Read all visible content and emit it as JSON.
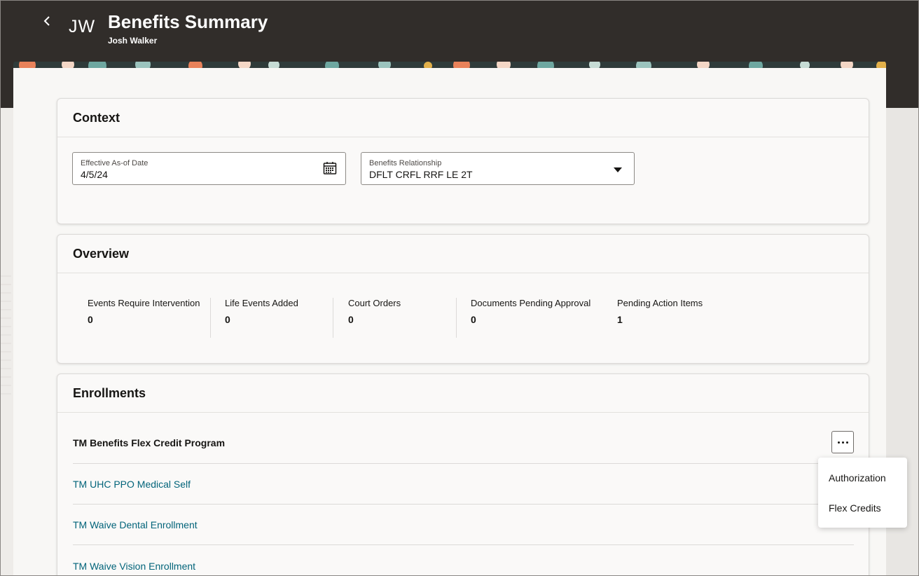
{
  "header": {
    "initials": "JW",
    "title": "Benefits Summary",
    "person_name": "Josh Walker"
  },
  "context": {
    "title": "Context",
    "effective_date": {
      "label": "Effective As-of Date",
      "value": "4/5/24"
    },
    "relationship": {
      "label": "Benefits Relationship",
      "value": "DFLT CRFL RRF LE 2T"
    }
  },
  "overview": {
    "title": "Overview",
    "metrics": [
      {
        "label": "Events Require Intervention",
        "value": "0"
      },
      {
        "label": "Life Events Added",
        "value": "0"
      },
      {
        "label": "Court Orders",
        "value": "0"
      },
      {
        "label": "Documents Pending Approval",
        "value": "0"
      },
      {
        "label": "Pending Action Items",
        "value": "1"
      }
    ]
  },
  "enrollments": {
    "title": "Enrollments",
    "program": "TM Benefits Flex Credit Program",
    "items": [
      {
        "label": "TM UHC PPO Medical Self"
      },
      {
        "label": "TM Waive Dental Enrollment"
      },
      {
        "label": "TM Waive Vision Enrollment"
      }
    ]
  },
  "actions_menu": {
    "items": [
      {
        "label": "Authorization"
      },
      {
        "label": "Flex Credits"
      }
    ]
  },
  "icons": {
    "back": "chevron-left-icon",
    "date": "calendar-icon",
    "dropdown": "caret-down-icon",
    "more": "more-actions-icon"
  },
  "colors": {
    "header_bg": "#312d2a",
    "link": "#02647a",
    "surface": "#faf9f8"
  }
}
